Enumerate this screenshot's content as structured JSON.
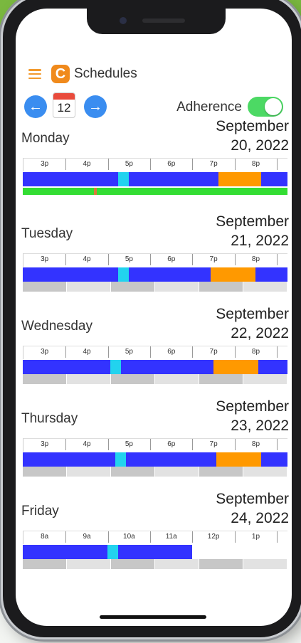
{
  "app": {
    "title": "Schedules",
    "logo_letter": "C"
  },
  "nav": {
    "calendar_day": "12",
    "prev_glyph": "←",
    "next_glyph": "→"
  },
  "adherence": {
    "label": "Adherence",
    "enabled": true
  },
  "colors": {
    "work": "#3333ff",
    "break": "#22d3ee",
    "lunch": "#ff9900",
    "adherence": "#33dd33",
    "accent": "#f08a1c"
  },
  "days": [
    {
      "name": "Monday",
      "date_line1": "September",
      "date_line2": "20, 2022",
      "ticks": [
        "3p",
        "4p",
        "5p",
        "6p",
        "7p",
        "8p"
      ],
      "adherence_bar": true
    },
    {
      "name": "Tuesday",
      "date_line1": "September",
      "date_line2": "21, 2022",
      "ticks": [
        "3p",
        "4p",
        "5p",
        "6p",
        "7p",
        "8p"
      ],
      "adherence_bar": false
    },
    {
      "name": "Wednesday",
      "date_line1": "September",
      "date_line2": "22, 2022",
      "ticks": [
        "3p",
        "4p",
        "5p",
        "6p",
        "7p",
        "8p"
      ],
      "adherence_bar": false
    },
    {
      "name": "Thursday",
      "date_line1": "September",
      "date_line2": "23, 2022",
      "ticks": [
        "3p",
        "4p",
        "5p",
        "6p",
        "7p",
        "8p"
      ],
      "adherence_bar": false
    },
    {
      "name": "Friday",
      "date_line1": "September",
      "date_line2": "24, 2022",
      "ticks": [
        "8a",
        "9a",
        "10a",
        "11a",
        "12p",
        "1p"
      ],
      "adherence_bar": false
    }
  ]
}
